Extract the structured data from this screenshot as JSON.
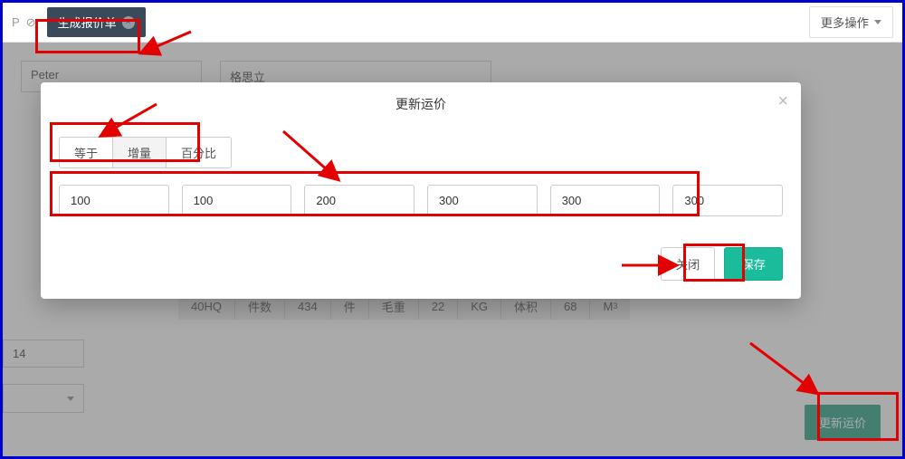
{
  "topbar": {
    "tab_label": "生成报价单",
    "more_label": "更多操作"
  },
  "background": {
    "name1": "Peter",
    "name2": "格思立",
    "number_field": "14",
    "info": {
      "c1": "40HQ",
      "c2_label": "件数",
      "c2_val": "434",
      "c2_unit": "件",
      "c3_label": "毛重",
      "c3_val": "22",
      "c3_unit": "KG",
      "c4_label": "体积",
      "c4_val": "68",
      "c4_unit": "M",
      "c4_sup": "3"
    },
    "update_btn": "更新运价"
  },
  "modal": {
    "title": "更新运价",
    "modes": [
      "等于",
      "增量",
      "百分比"
    ],
    "active_mode_index": 1,
    "values": [
      "100",
      "100",
      "200",
      "300",
      "300",
      "300"
    ],
    "close_label": "关闭",
    "save_label": "保存"
  }
}
